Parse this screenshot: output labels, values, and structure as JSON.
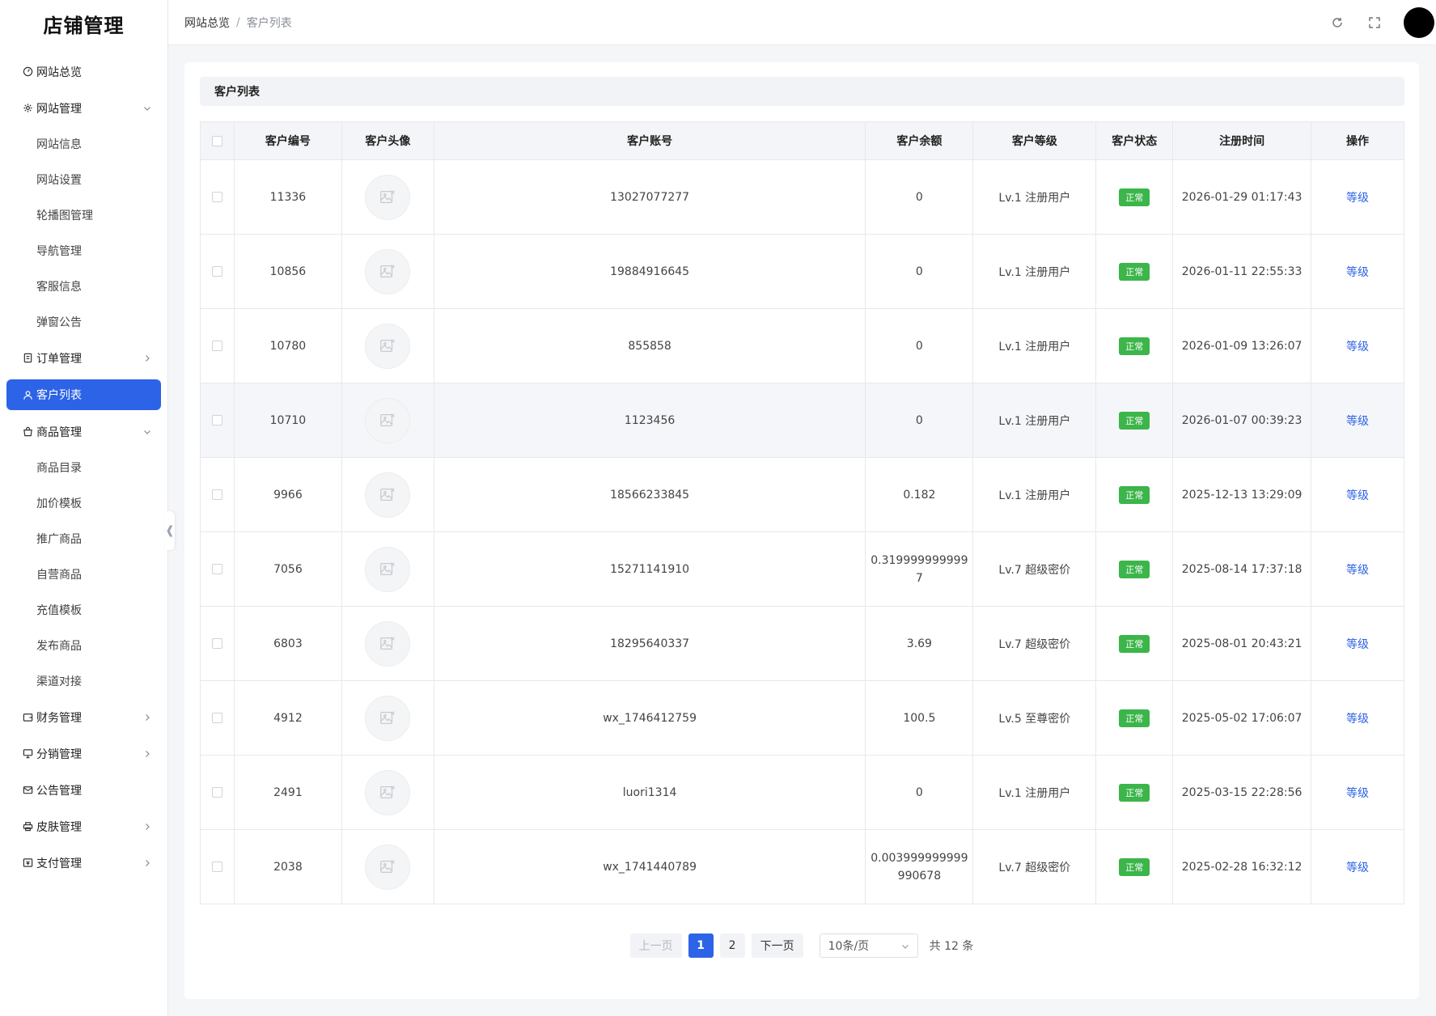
{
  "sidebar": {
    "logo": "店铺管理",
    "items": [
      {
        "label": "网站总览",
        "icon": "dashboard-icon"
      },
      {
        "label": "网站管理",
        "icon": "gear-icon",
        "expanded": true,
        "children": [
          "网站信息",
          "网站设置",
          "轮播图管理",
          "导航管理",
          "客服信息",
          "弹窗公告"
        ]
      },
      {
        "label": "订单管理",
        "icon": "document-icon"
      },
      {
        "label": "客户列表",
        "icon": "user-icon",
        "active": true
      },
      {
        "label": "商品管理",
        "icon": "bag-icon",
        "expanded": true,
        "children": [
          "商品目录",
          "加价模板",
          "推广商品",
          "自营商品",
          "充值模板",
          "发布商品",
          "渠道对接"
        ]
      },
      {
        "label": "财务管理",
        "icon": "wallet-icon"
      },
      {
        "label": "分销管理",
        "icon": "monitor-icon"
      },
      {
        "label": "公告管理",
        "icon": "mail-icon"
      },
      {
        "label": "皮肤管理",
        "icon": "printer-icon"
      },
      {
        "label": "支付管理",
        "icon": "pay-icon"
      }
    ]
  },
  "header": {
    "breadcrumb": [
      "网站总览",
      "客户列表"
    ],
    "refresh_icon": "refresh-icon",
    "fullscreen_icon": "fullscreen-icon"
  },
  "card": {
    "title": "客户列表"
  },
  "table": {
    "columns": [
      "客户编号",
      "客户头像",
      "客户账号",
      "客户余额",
      "客户等级",
      "客户状态",
      "注册时间",
      "操作"
    ],
    "rows": [
      {
        "id": "11336",
        "account": "13027077277",
        "balance": "0",
        "level": "Lv.1 注册用户",
        "status": "正常",
        "time": "2026-01-29 01:17:43",
        "action": "等级"
      },
      {
        "id": "10856",
        "account": "19884916645",
        "balance": "0",
        "level": "Lv.1 注册用户",
        "status": "正常",
        "time": "2026-01-11 22:55:33",
        "action": "等级"
      },
      {
        "id": "10780",
        "account": "855858",
        "balance": "0",
        "level": "Lv.1 注册用户",
        "status": "正常",
        "time": "2026-01-09 13:26:07",
        "action": "等级"
      },
      {
        "id": "10710",
        "account": "1123456",
        "balance": "0",
        "level": "Lv.1 注册用户",
        "status": "正常",
        "time": "2026-01-07 00:39:23",
        "action": "等级"
      },
      {
        "id": "9966",
        "account": "18566233845",
        "balance": "0.182",
        "level": "Lv.1 注册用户",
        "status": "正常",
        "time": "2025-12-13 13:29:09",
        "action": "等级"
      },
      {
        "id": "7056",
        "account": "15271141910",
        "balance": "0.319999999999\n7",
        "level": "Lv.7 超级密价",
        "status": "正常",
        "time": "2025-08-14 17:37:18",
        "action": "等级"
      },
      {
        "id": "6803",
        "account": "18295640337",
        "balance": "3.69",
        "level": "Lv.7 超级密价",
        "status": "正常",
        "time": "2025-08-01 20:43:21",
        "action": "等级"
      },
      {
        "id": "4912",
        "account": "wx_1746412759",
        "balance": "100.5",
        "level": "Lv.5 至尊密价",
        "status": "正常",
        "time": "2025-05-02 17:06:07",
        "action": "等级"
      },
      {
        "id": "2491",
        "account": "luori1314",
        "balance": "0",
        "level": "Lv.1 注册用户",
        "status": "正常",
        "time": "2025-03-15 22:28:56",
        "action": "等级"
      },
      {
        "id": "2038",
        "account": "wx_1741440789",
        "balance": "0.003999999999\n990678",
        "level": "Lv.7 超级密价",
        "status": "正常",
        "time": "2025-02-28 16:32:12",
        "action": "等级"
      }
    ]
  },
  "pagination": {
    "prev": "上一页",
    "pages": [
      "1",
      "2"
    ],
    "current": "1",
    "next": "下一页",
    "page_size": "10条/页",
    "total": "共 12 条"
  },
  "colors": {
    "accent": "#2d63e6",
    "status_ok": "#3cb54a"
  }
}
